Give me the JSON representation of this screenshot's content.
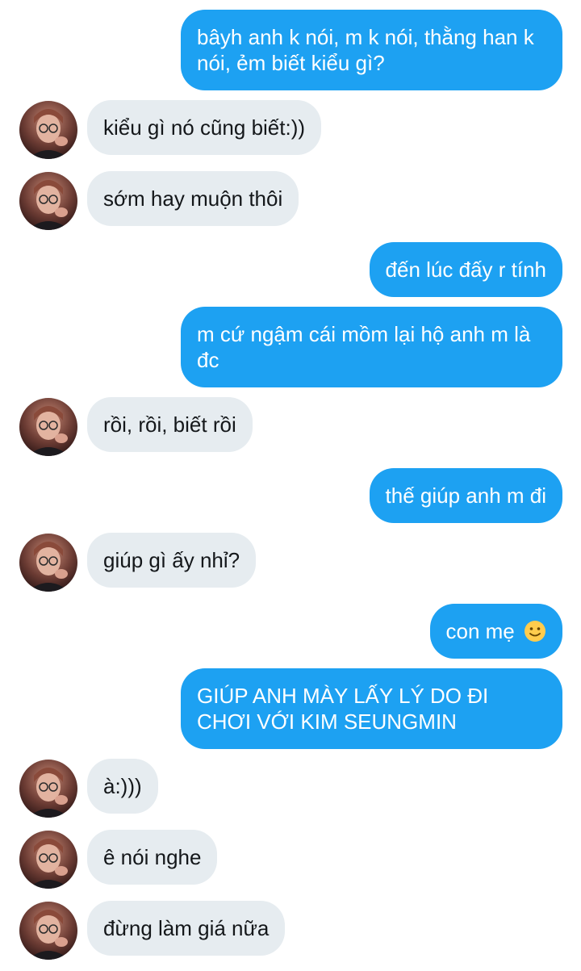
{
  "conversation": {
    "messages": [
      {
        "side": "out",
        "text": "bâyh anh k nói, m k nói, thằng han k nói, ẻm biết kiểu gì?"
      },
      {
        "side": "in",
        "text": "kiểu gì nó cũng biết:))"
      },
      {
        "side": "in",
        "text": "sớm hay muộn thôi"
      },
      {
        "side": "out",
        "text": "đến lúc đấy r tính"
      },
      {
        "side": "out",
        "text": "m cứ ngậm cái mồm lại hộ anh m là đc"
      },
      {
        "side": "in",
        "text": "rồi, rồi, biết rồi"
      },
      {
        "side": "out",
        "text": "thế giúp anh m đi"
      },
      {
        "side": "in",
        "text": "giúp gì ấy nhỉ?"
      },
      {
        "side": "out",
        "text": "con mẹ",
        "emoji": "slightly-smiling-face"
      },
      {
        "side": "out",
        "text": "GIÚP ANH MÀY LẤY LÝ DO ĐI CHƠI VỚI KIM SEUNGMIN"
      },
      {
        "side": "in",
        "text": "à:)))"
      },
      {
        "side": "in",
        "text": "ê nói nghe"
      },
      {
        "side": "in",
        "text": "đừng làm giá nữa"
      }
    ]
  },
  "colors": {
    "outgoing_bubble": "#1da1f2",
    "incoming_bubble": "#e6ecf0",
    "outgoing_text": "#ffffff",
    "incoming_text": "#14171a",
    "background": "#ffffff"
  }
}
